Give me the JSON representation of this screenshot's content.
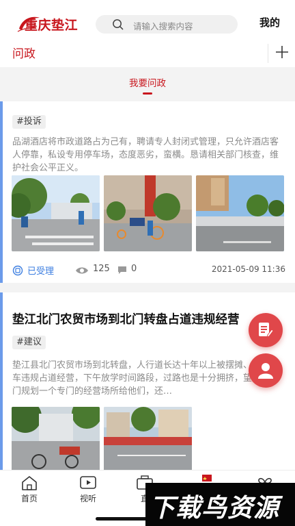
{
  "header": {
    "logo_text": "重庆垫江",
    "search_placeholder": "请输入搜索内容",
    "mine_label": "我的"
  },
  "category": {
    "label": "问政"
  },
  "tab": {
    "label": "我要问政"
  },
  "posts": [
    {
      "tag": "#投诉",
      "body": "品湖酒店将市政道路占为己有，聘请专人封闭式管理，只允许酒店客人停靠，私设专用停车场，态度恶劣，蛮横。恳请相关部门核查，维护社会公平正义。",
      "status": "已受理",
      "views": "125",
      "comments": "0",
      "date": "2021-05-09 11:36"
    },
    {
      "title": "垫江北门农贸市场到北门转盘占道违规经营",
      "tag": "#建议",
      "body": "垫江县北门农贸市场到北转盘，人行道长达十年以上被摆摊、放摩托车违规占道经营，下午放学时间路段，过路也是十分拥挤，望相关部门规划一个专门的经营场所给他们，还…"
    }
  ],
  "nav": {
    "items": [
      {
        "label": "首页",
        "icon": "home-icon"
      },
      {
        "label": "视听",
        "icon": "video-play-icon"
      },
      {
        "label": "直",
        "icon": "camera-icon"
      },
      {
        "label": "",
        "icon": "flag-icon"
      },
      {
        "label": "",
        "icon": "heart-icon"
      }
    ]
  },
  "watermark": "下载鸟资源",
  "colors": {
    "brand_red": "#c8161d",
    "fab_red": "#e0474a",
    "status_blue": "#3b7de0",
    "card_accent": "#6b9bea"
  }
}
